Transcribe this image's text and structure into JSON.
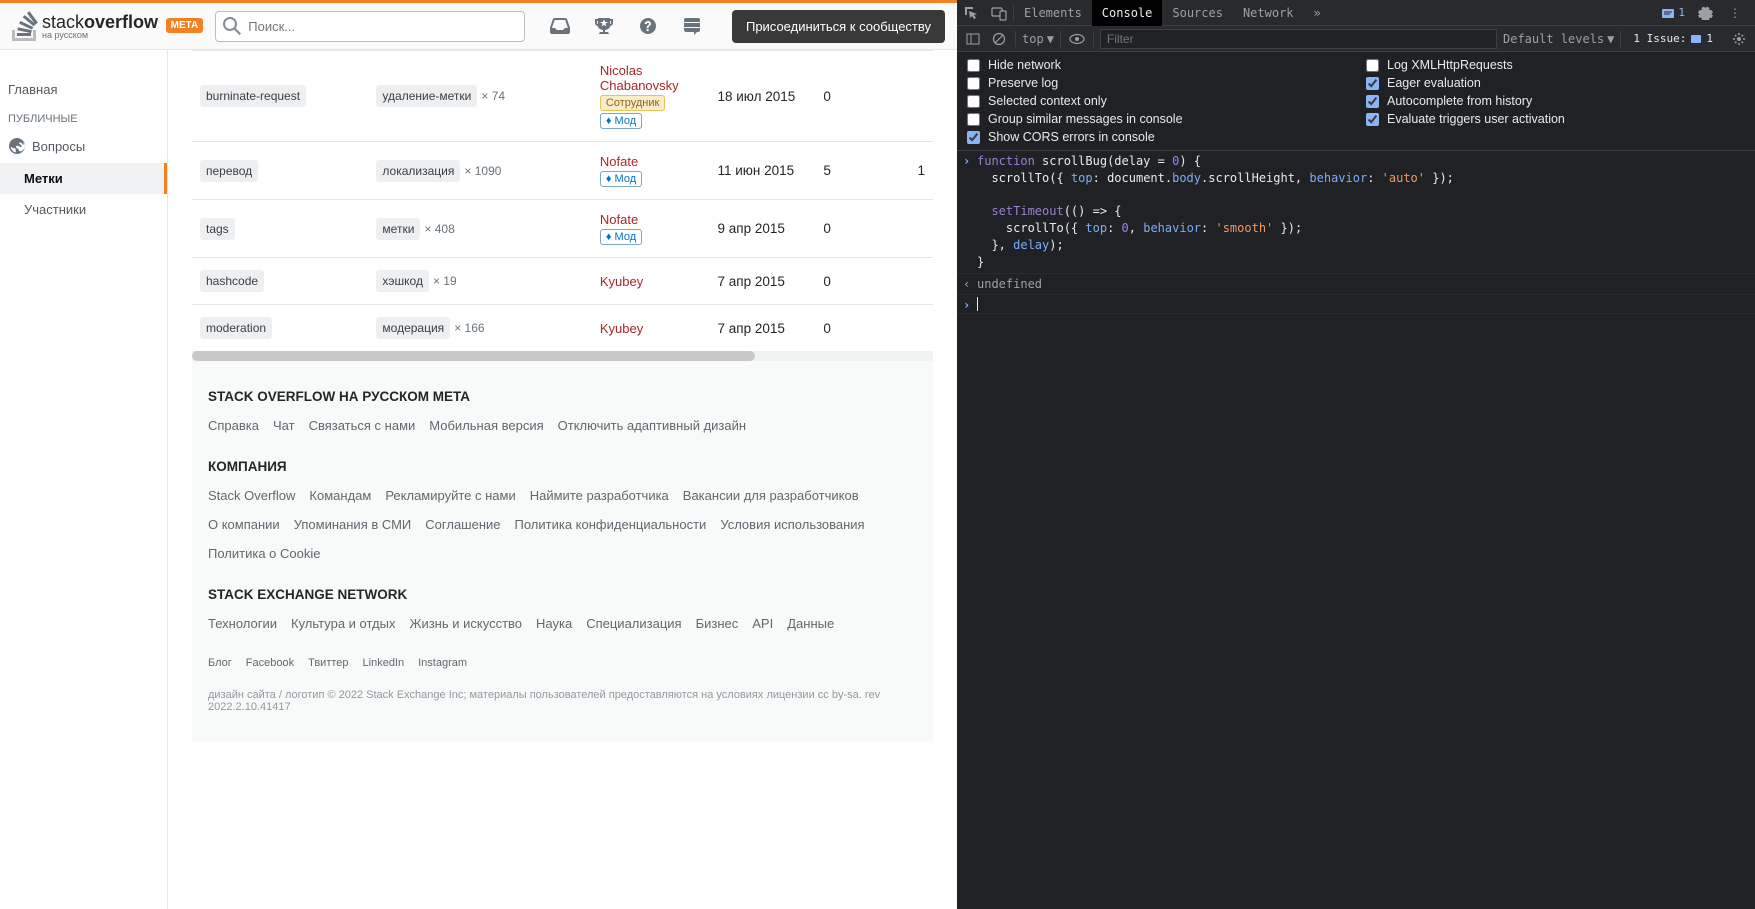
{
  "header": {
    "logo_main": "stack",
    "logo_bold": "overflow",
    "logo_sub": "на русском",
    "meta_badge": "META",
    "search_placeholder": "Поиск...",
    "join_btn": "Присоединиться к сообществу"
  },
  "sidebar": {
    "home": "Главная",
    "public_header": "ПУБЛИЧНЫЕ",
    "questions": "Вопросы",
    "tags": "Метки",
    "users": "Участники"
  },
  "table": {
    "rows": [
      {
        "tag1": "burninate-request",
        "tag2": "удаление-метки",
        "mult": "× 74",
        "user": "Nicolas Chabanovsky",
        "staff": "Сотрудник",
        "mod": "♦ Мод",
        "date": "18 июл 2015",
        "c1": "0",
        "c2": ""
      },
      {
        "tag1": "перевод",
        "tag2": "локализация",
        "mult": "× 1090",
        "user": "Nofate",
        "staff": "",
        "mod": "♦ Мод",
        "date": "11 июн 2015",
        "c1": "5",
        "c2": "1"
      },
      {
        "tag1": "tags",
        "tag2": "метки",
        "mult": "× 408",
        "user": "Nofate",
        "staff": "",
        "mod": "♦ Мод",
        "date": "9 апр 2015",
        "c1": "0",
        "c2": ""
      },
      {
        "tag1": "hashcode",
        "tag2": "хэшкод",
        "mult": "× 19",
        "user": "Kyubey",
        "staff": "",
        "mod": "",
        "date": "7 апр 2015",
        "c1": "0",
        "c2": ""
      },
      {
        "tag1": "moderation",
        "tag2": "модерация",
        "mult": "× 166",
        "user": "Kyubey",
        "staff": "",
        "mod": "",
        "date": "7 апр 2015",
        "c1": "0",
        "c2": ""
      }
    ]
  },
  "footer": {
    "s1_title": "STACK OVERFLOW НА РУССКОМ META",
    "s1_links": [
      "Справка",
      "Чат",
      "Связаться с нами",
      "Мобильная версия",
      "Отключить адаптивный дизайн"
    ],
    "s2_title": "КОМПАНИЯ",
    "s2_links": [
      "Stack Overflow",
      "Командам",
      "Рекламируйте с нами",
      "Наймите разработчика",
      "Вакансии для разработчиков",
      "О компании",
      "Упоминания в СМИ",
      "Соглашение",
      "Политика конфиденциальности",
      "Условия использования",
      "Политика о Cookie"
    ],
    "s3_title": "STACK EXCHANGE NETWORK",
    "s3_links": [
      "Технологии",
      "Культура и отдых",
      "Жизнь и искусство",
      "Наука",
      "Специализация",
      "Бизнес",
      "API",
      "Данные"
    ],
    "social": [
      "Блог",
      "Facebook",
      "Твиттер",
      "LinkedIn",
      "Instagram"
    ],
    "copy": "дизайн сайта / логотип © 2022 Stack Exchange Inc; материалы пользователей предоставляются на условиях лицензии cc by-sa. rev 2022.2.10.41417"
  },
  "devtools": {
    "tabs": [
      "Elements",
      "Console",
      "Sources",
      "Network"
    ],
    "issue_badge": "1",
    "toolbar": {
      "context": "top",
      "filter_placeholder": "Filter",
      "levels": "Default levels",
      "issues": "1 Issue:",
      "issues_count": "1"
    },
    "settings": {
      "left": [
        "Hide network",
        "Preserve log",
        "Selected context only",
        "Group similar messages in console",
        "Show CORS errors in console"
      ],
      "right": [
        "Log XMLHttpRequests",
        "Eager evaluation",
        "Autocomplete from history",
        "Evaluate triggers user activation"
      ],
      "left_checked": [
        false,
        false,
        false,
        false,
        true
      ],
      "right_checked": [
        false,
        true,
        true,
        true
      ]
    },
    "console": {
      "code_lines": [
        "function scrollBug(delay = 0) {",
        "  scrollTo({ top: document.body.scrollHeight, behavior: 'auto' });",
        "",
        "  setTimeout(() => {",
        "    scrollTo({ top: 0, behavior: 'smooth' });",
        "  }, delay);",
        "}"
      ],
      "output": "undefined"
    }
  }
}
